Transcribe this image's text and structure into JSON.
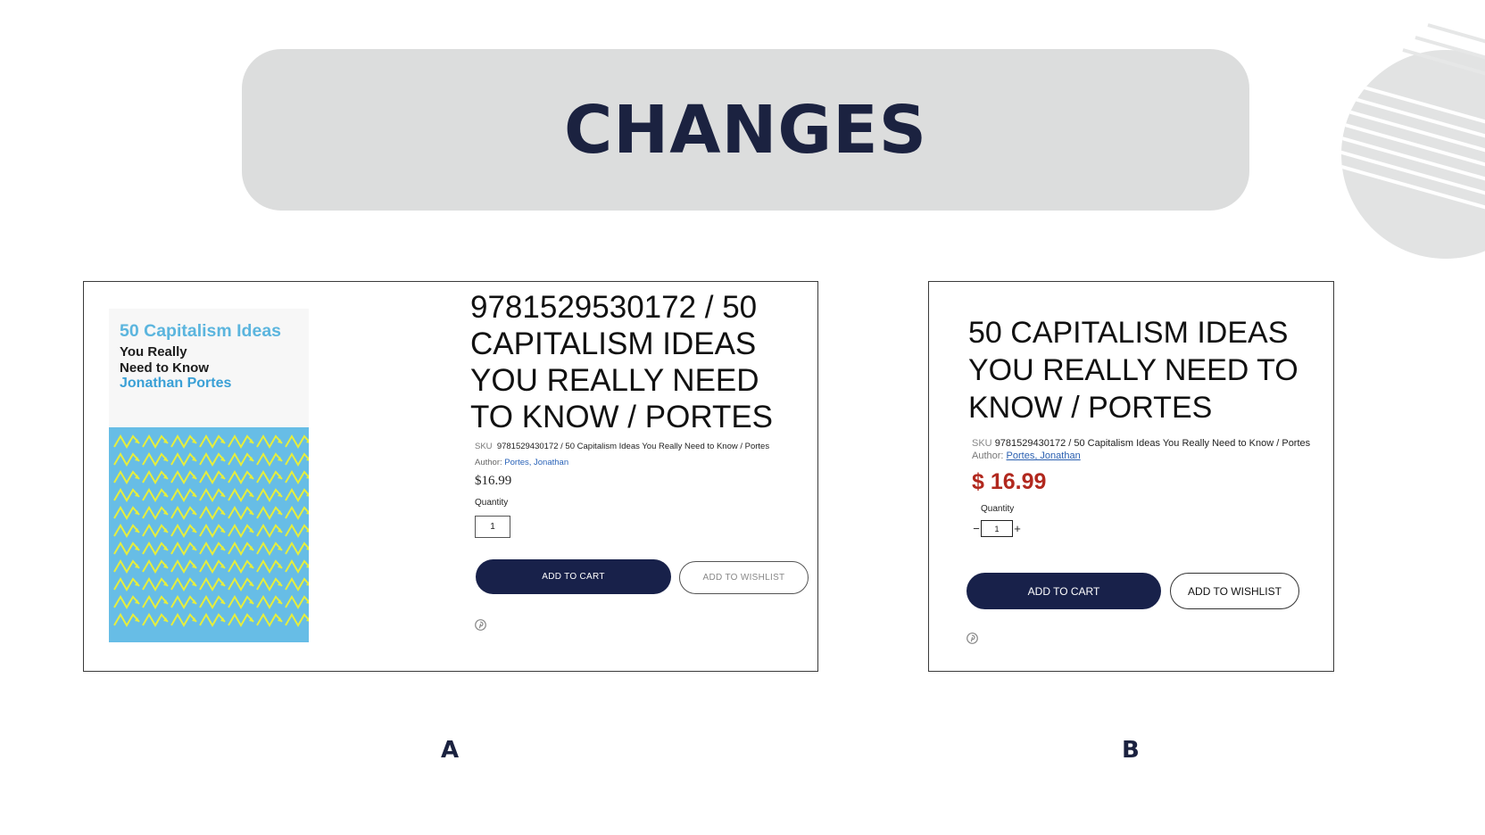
{
  "heading": "CHANGES",
  "version_a": {
    "label": "A",
    "cover": {
      "title_line1": "50 Capitalism Ideas",
      "title_line2": "You Really",
      "title_line3": "Need to Know",
      "author": "Jonathan Portes"
    },
    "title": "9781529530172 / 50 CAPITALISM IDEAS YOU REALLY NEED TO KNOW / PORTES",
    "sku_label": "SKU",
    "sku_value": "9781529430172 / 50 Capitalism Ideas You Really Need to Know / Portes",
    "author_label": "Author:",
    "author_value": "Portes, Jonathan",
    "price": "$16.99",
    "quantity_label": "Quantity",
    "quantity_value": "1",
    "add_to_cart": "ADD TO CART",
    "add_to_wishlist": "ADD TO WISHLIST",
    "share_icon": "pinterest-icon"
  },
  "version_b": {
    "label": "B",
    "title": "50 CAPITALISM IDEAS YOU REALLY NEED TO KNOW / PORTES",
    "sku_label": "SKU",
    "sku_value": "9781529430172 / 50 Capitalism Ideas You Really Need to Know / Portes",
    "author_label": "Author:",
    "author_value": "Portes, Jonathan",
    "price": "$ 16.99",
    "price_color": "#b1281e",
    "quantity_label": "Quantity",
    "quantity_value": "1",
    "decrement": "−",
    "increment": "+",
    "add_to_cart": "ADD TO CART",
    "add_to_wishlist": "ADD TO WISHLIST",
    "share_icon": "pinterest-icon"
  },
  "colors": {
    "navy": "#18214a",
    "banner_bg": "#dcdddd",
    "cover_blue": "#67bde6",
    "cover_yellow": "#e6ee3c"
  }
}
